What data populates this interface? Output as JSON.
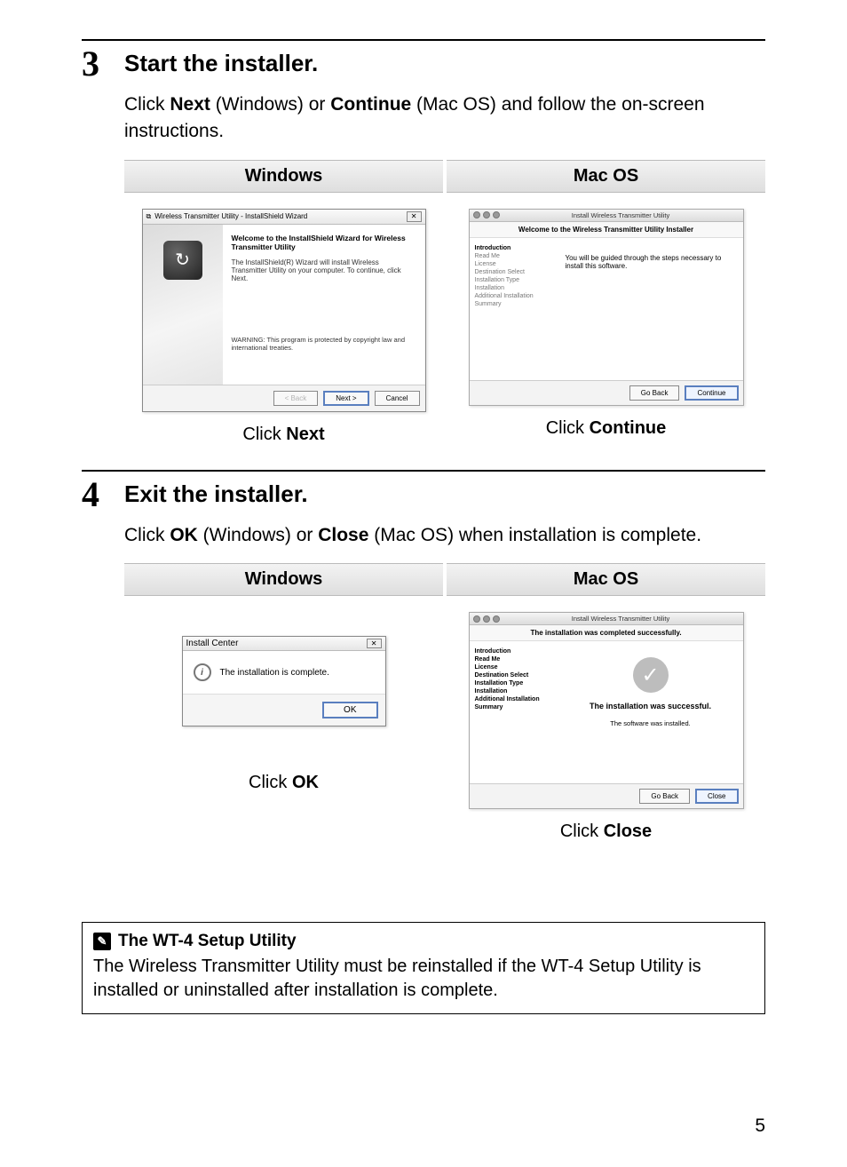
{
  "step3": {
    "num": "3",
    "title": "Start the installer.",
    "text_1": "Click ",
    "text_next": "Next",
    "text_2": " (Windows) or ",
    "text_continue": "Continue",
    "text_3": " (Mac OS) and follow the on-screen instructions.",
    "os_win": "Windows",
    "os_mac": "Mac OS",
    "win_caption_1": "Click ",
    "win_caption_2": "Next",
    "mac_caption_1": "Click ",
    "mac_caption_2": "Continue",
    "win_shot": {
      "titlebar": "Wireless Transmitter Utility - InstallShield Wizard",
      "heading": "Welcome to the InstallShield Wizard for Wireless Transmitter Utility",
      "para": "The InstallShield(R) Wizard will install Wireless Transmitter Utility on your computer. To continue, click Next.",
      "warn": "WARNING: This program is protected by copyright law and international treaties.",
      "btn_back": "< Back",
      "btn_next": "Next >",
      "btn_cancel": "Cancel"
    },
    "mac_shot": {
      "titlebar": "Install Wireless Transmitter Utility",
      "heading": "Welcome to the Wireless Transmitter Utility Installer",
      "sidebar": [
        "Introduction",
        "Read Me",
        "License",
        "Destination Select",
        "Installation Type",
        "Installation",
        "Additional Installation",
        "Summary"
      ],
      "para": "You will be guided through the steps necessary to install this software.",
      "btn_back": "Go Back",
      "btn_cont": "Continue"
    }
  },
  "step4": {
    "num": "4",
    "title": "Exit the installer.",
    "text_1": "Click ",
    "text_ok": "OK",
    "text_2": " (Windows) or ",
    "text_close": "Close",
    "text_3": " (Mac OS) when installation is complete.",
    "os_win": "Windows",
    "os_mac": "Mac OS",
    "win_caption_1": "Click ",
    "win_caption_2": "OK",
    "mac_caption_1": "Click ",
    "mac_caption_2": "Close",
    "win_shot": {
      "titlebar": "Install Center",
      "msg": "The installation is complete.",
      "btn_ok": "OK"
    },
    "mac_shot": {
      "titlebar": "Install Wireless Transmitter Utility",
      "heading": "The installation was completed successfully.",
      "sidebar": [
        "Introduction",
        "Read Me",
        "License",
        "Destination Select",
        "Installation Type",
        "Installation",
        "Additional Installation",
        "Summary"
      ],
      "succ_title": "The installation was successful.",
      "succ_sub": "The software was installed.",
      "btn_back": "Go Back",
      "btn_close": "Close"
    }
  },
  "note": {
    "title": "The WT-4 Setup Utility",
    "body": "The Wireless Transmitter Utility must be reinstalled if the WT-4 Setup Utility is installed or uninstalled after installation is complete."
  },
  "pagenum": "5"
}
